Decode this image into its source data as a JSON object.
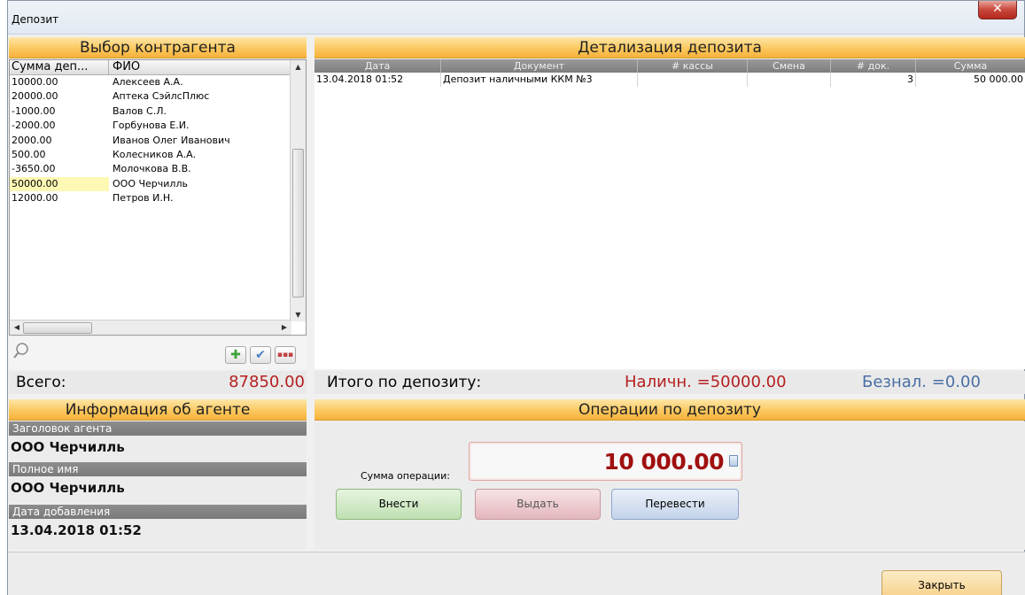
{
  "window": {
    "title": "Депозит",
    "close_glyph": "✕"
  },
  "left": {
    "header": "Выбор контрагента",
    "columns": {
      "sum": "Сумма деп...",
      "name": "ФИО"
    },
    "rows": [
      {
        "sum": "10000.00",
        "name": "Алексеев А.А."
      },
      {
        "sum": "20000.00",
        "name": "Аптека СэйлсПлюс"
      },
      {
        "sum": "-1000.00",
        "name": "Валов С.Л."
      },
      {
        "sum": "-2000.00",
        "name": "Горбунова Е.И."
      },
      {
        "sum": "2000.00",
        "name": "Иванов Олег Иванович"
      },
      {
        "sum": "500.00",
        "name": "Колесников А.А."
      },
      {
        "sum": "-3650.00",
        "name": "Молочкова В.В."
      },
      {
        "sum": "50000.00",
        "name": "ООО Черчилль"
      },
      {
        "sum": "12000.00",
        "name": "Петров И.Н."
      }
    ],
    "selected_row": 7,
    "total_label": "Всего:",
    "total_value": "87850.00",
    "total_color": "#b52020"
  },
  "detail": {
    "header": "Детализация депозита",
    "columns": [
      "Дата",
      "Документ",
      "# кассы",
      "Смена",
      "# док.",
      "Сумма"
    ],
    "rows": [
      {
        "date": "13.04.2018 01:52",
        "doc": "Депозит наличными ККМ №3",
        "kassa": "",
        "shift": "",
        "docno": "3",
        "sum": "50 000.00"
      }
    ],
    "totals_label": "Итого по депозиту:",
    "cash_label": "Наличн. =50000.00",
    "noncash_label": "Безнал. =0.00",
    "cash_color": "#b52020",
    "noncash_color": "#4a6fa5"
  },
  "agent": {
    "header": "Информация об агенте",
    "fields": [
      {
        "label": "Заголовок агента",
        "value": "ООО Черчилль"
      },
      {
        "label": "Полное имя",
        "value": "ООО Черчилль"
      },
      {
        "label": "Дата добавления",
        "value": "13.04.2018 01:52"
      }
    ]
  },
  "operations": {
    "header": "Операции по депозиту",
    "amount_label": "Сумма операции:",
    "amount_value": "10 000.00",
    "buttons": {
      "deposit": "Внести",
      "withdraw": "Выдать",
      "transfer": "Перевести"
    }
  },
  "footer": {
    "close_label": "Закрыть"
  },
  "icons": {
    "search": "search-icon",
    "add": "plus-icon",
    "confirm": "check-icon",
    "more": "ellipsis-icon",
    "calculator": "calculator-icon"
  },
  "colors": {
    "accent_header": "#fbc85f"
  }
}
